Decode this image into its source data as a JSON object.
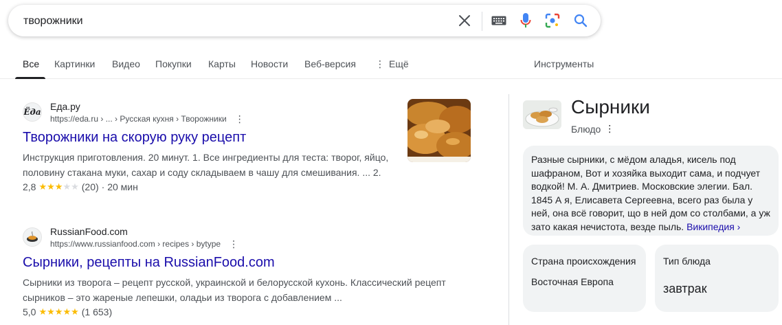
{
  "search": {
    "query": "творожники"
  },
  "tabs": [
    {
      "label": "Все"
    },
    {
      "label": "Картинки"
    },
    {
      "label": "Видео"
    },
    {
      "label": "Покупки"
    },
    {
      "label": "Карты"
    },
    {
      "label": "Новости"
    },
    {
      "label": "Веб-версия"
    },
    {
      "label": "Ещё"
    }
  ],
  "tools_label": "Инструменты",
  "results": [
    {
      "site_name": "Еда.ру",
      "favicon_text": "Ёда",
      "url": "https://eda.ru › ... › Русская кухня › Творожники",
      "title": "Творожники на скорую руку рецепт",
      "snippet": "Инструкция приготовления. 20 минут. 1. Все ингредиенты для теста: творог, яйцо, половину стакана муки, сахар и соду складываем в чашу для смешивания. ... 2.",
      "rating": "2,8",
      "rating_stars": 3,
      "rating_count": "(20)",
      "extra": "· 20 мин"
    },
    {
      "site_name": "RussianFood.com",
      "url": "https://www.russianfood.com › recipes › bytype",
      "title": "Сырники, рецепты на RussianFood.com",
      "snippet": "Сырники из творога – рецепт русской, украинской и белорусской кухонь. Классический рецепт сырников – это жареные лепешки, оладьи из творога с добавлением ...",
      "rating": "5,0",
      "rating_stars": 5,
      "rating_count": "(1 653)",
      "extra": ""
    }
  ],
  "knowledge_panel": {
    "title": "Сырники",
    "subtitle": "Блюдо",
    "description": "Разные сырники, с мёдом аладья, кисель под шафраном, Вот и хозяйка выходит сама, и подчует водкой! М. А. Дмитриев. Московские элегии. Бал. 1845 А я, Елисавета Сергеевна, всего раз была у ней, она всё говорит, що в ней дом со столбами, а уж зато какая нечистота, везде пыль.",
    "wiki_link": "Википедия ›",
    "facts": [
      {
        "label": "Страна происхождения",
        "value": "Восточная Европа"
      },
      {
        "label": "Тип блюда",
        "value": "завтрак"
      }
    ]
  },
  "colors": {
    "link": "#1a0dab",
    "star": "#fbbc04",
    "text_secondary": "#4d5156"
  }
}
